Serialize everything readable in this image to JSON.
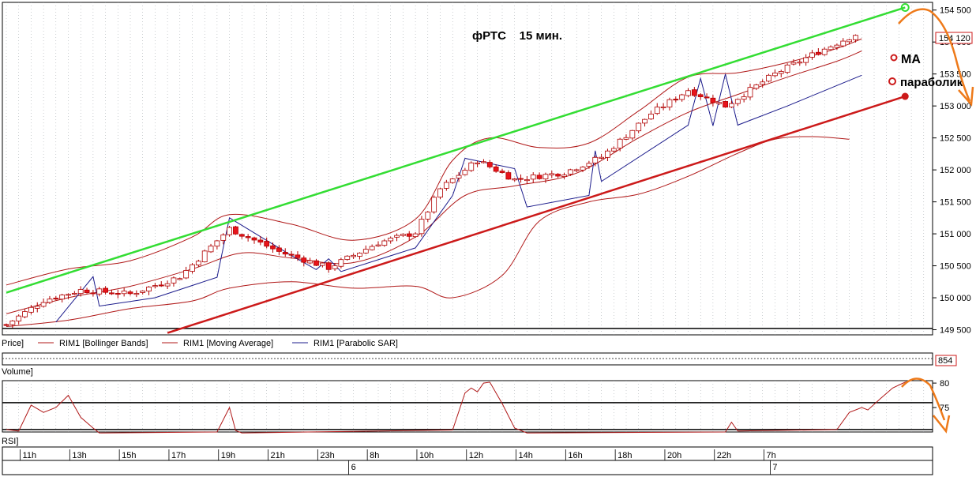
{
  "colors": {
    "bull": "#ffffff",
    "bear": "#e8141c",
    "wick": "#b00000",
    "band": "#b01818",
    "ma": "#b01818",
    "sar": "#1c1c8c",
    "green_trend": "#33dd33",
    "red_trend": "#cc1a1a",
    "orange": "#ee7a1a",
    "grid": "#9aa0a6"
  },
  "chart_data": {
    "type": "candlestick",
    "title": "фРТС    15 мин.",
    "price_axis": {
      "ylim": [
        149420,
        154620
      ],
      "ticks": [
        "154 500",
        "153 000",
        "152 500",
        "152 000",
        "151 500",
        "151 000",
        "150 500",
        "150 000",
        "149 500"
      ],
      "tick_values": [
        154500,
        153000,
        152500,
        152000,
        151500,
        151000,
        150500,
        150000,
        149500
      ],
      "partial_ticks": [
        "154 000",
        "153 500"
      ],
      "partial_tick_values": [
        154000,
        153500
      ],
      "last_price_label": "154 120",
      "last_price": 154120
    },
    "x_axis": {
      "bar_count": 150,
      "hour_labels": [
        "11h",
        "13h",
        "15h",
        "17h",
        "19h",
        "21h",
        "23h",
        "8h",
        "10h",
        "12h",
        "14h",
        "16h",
        "18h",
        "20h",
        "22h",
        "7h"
      ],
      "hour_label_bars": [
        3,
        11,
        19,
        27,
        35,
        43,
        51,
        59,
        67,
        75,
        83,
        91,
        99,
        107,
        115,
        123
      ],
      "day_labels": [
        "6",
        "7"
      ],
      "day_label_bars": [
        56,
        124
      ]
    },
    "candle_anchors": [
      [
        0,
        149580
      ],
      [
        6,
        149960
      ],
      [
        12,
        150120
      ],
      [
        20,
        150060
      ],
      [
        28,
        150330
      ],
      [
        36,
        151080
      ],
      [
        44,
        150720
      ],
      [
        52,
        150470
      ],
      [
        60,
        150860
      ],
      [
        66,
        151020
      ],
      [
        70,
        151700
      ],
      [
        76,
        152150
      ],
      [
        82,
        151850
      ],
      [
        90,
        151960
      ],
      [
        96,
        152200
      ],
      [
        104,
        152880
      ],
      [
        110,
        153250
      ],
      [
        116,
        153000
      ],
      [
        124,
        153500
      ],
      [
        130,
        153800
      ],
      [
        137,
        154120
      ]
    ],
    "bollinger_upper": [
      [
        0,
        150200
      ],
      [
        10,
        150450
      ],
      [
        20,
        150580
      ],
      [
        30,
        150950
      ],
      [
        36,
        151300
      ],
      [
        46,
        151150
      ],
      [
        56,
        150900
      ],
      [
        66,
        151230
      ],
      [
        72,
        152150
      ],
      [
        78,
        152500
      ],
      [
        86,
        152350
      ],
      [
        94,
        152420
      ],
      [
        102,
        152920
      ],
      [
        110,
        153450
      ],
      [
        118,
        153520
      ],
      [
        126,
        153680
      ],
      [
        134,
        153900
      ],
      [
        138,
        154050
      ]
    ],
    "bollinger_lower": [
      [
        0,
        149550
      ],
      [
        10,
        149650
      ],
      [
        20,
        149830
      ],
      [
        30,
        149950
      ],
      [
        36,
        150150
      ],
      [
        46,
        150250
      ],
      [
        56,
        150150
      ],
      [
        66,
        150180
      ],
      [
        72,
        150000
      ],
      [
        80,
        150350
      ],
      [
        86,
        151200
      ],
      [
        94,
        151500
      ],
      [
        102,
        151620
      ],
      [
        110,
        151900
      ],
      [
        118,
        152260
      ],
      [
        124,
        152480
      ],
      [
        130,
        152520
      ],
      [
        136,
        152480
      ]
    ],
    "moving_average": [
      [
        0,
        149750
      ],
      [
        10,
        150000
      ],
      [
        20,
        150180
      ],
      [
        30,
        150450
      ],
      [
        38,
        150700
      ],
      [
        46,
        150620
      ],
      [
        56,
        150550
      ],
      [
        66,
        150950
      ],
      [
        74,
        151600
      ],
      [
        82,
        151750
      ],
      [
        92,
        151950
      ],
      [
        102,
        152500
      ],
      [
        110,
        152900
      ],
      [
        118,
        153180
      ],
      [
        126,
        153450
      ],
      [
        134,
        153700
      ],
      [
        138,
        153860
      ]
    ],
    "parabolic_sar": [
      [
        8,
        149620
      ],
      [
        14,
        150330
      ],
      [
        15,
        149870
      ],
      [
        24,
        150000
      ],
      [
        34,
        150320
      ],
      [
        36,
        151250
      ],
      [
        46,
        150660
      ],
      [
        50,
        150440
      ],
      [
        52,
        150610
      ],
      [
        54,
        150410
      ],
      [
        66,
        150780
      ],
      [
        72,
        151600
      ],
      [
        74,
        152180
      ],
      [
        82,
        152020
      ],
      [
        84,
        151420
      ],
      [
        94,
        151600
      ],
      [
        95,
        152300
      ],
      [
        96,
        151820
      ],
      [
        110,
        152700
      ],
      [
        112,
        153430
      ],
      [
        114,
        152690
      ],
      [
        116,
        153500
      ],
      [
        118,
        152700
      ],
      [
        126,
        153000
      ],
      [
        138,
        153480
      ]
    ],
    "trendlines": [
      {
        "color": "green",
        "from": [
          0,
          150080
        ],
        "to": [
          145,
          154540
        ]
      },
      {
        "color": "red",
        "from": [
          26,
          149450
        ],
        "to": [
          145,
          153150
        ]
      }
    ],
    "horizontal_line": 149520,
    "legend": [
      "Price]",
      "RIM1 [Bollinger Bands]",
      "RIM1 [Moving Average]",
      "RIM1 [Parabolic SAR]"
    ],
    "annotations": {
      "ma": "MA",
      "sar": "параболик"
    },
    "volume": {
      "label": "Volume]",
      "value_label": "854"
    },
    "rsi": {
      "label": "RSI]",
      "ylim": [
        70,
        80.5
      ],
      "ticks": [
        "80",
        "75"
      ],
      "tick_values": [
        80,
        75
      ],
      "levels": [
        76,
        70.5
      ],
      "points": [
        [
          0,
          70.5
        ],
        [
          2,
          70.2
        ],
        [
          4,
          75.5
        ],
        [
          6,
          74
        ],
        [
          8,
          75
        ],
        [
          10,
          77.5
        ],
        [
          12,
          73
        ],
        [
          14,
          70.8
        ],
        [
          15,
          69.8
        ],
        [
          34,
          70
        ],
        [
          36,
          75
        ],
        [
          37,
          70.3
        ],
        [
          38,
          69.8
        ],
        [
          72,
          70.4
        ],
        [
          74,
          78
        ],
        [
          75,
          79
        ],
        [
          76,
          78.2
        ],
        [
          77,
          80
        ],
        [
          78,
          80.2
        ],
        [
          80,
          75.8
        ],
        [
          82,
          70.8
        ],
        [
          84,
          69.8
        ],
        [
          116,
          70
        ],
        [
          117,
          72
        ],
        [
          118,
          70.2
        ],
        [
          134,
          70.5
        ],
        [
          136,
          74
        ],
        [
          138,
          75
        ],
        [
          139,
          74.5
        ],
        [
          141,
          76.8
        ],
        [
          143,
          79
        ],
        [
          145,
          80.2
        ],
        [
          146,
          80.5
        ]
      ]
    }
  }
}
